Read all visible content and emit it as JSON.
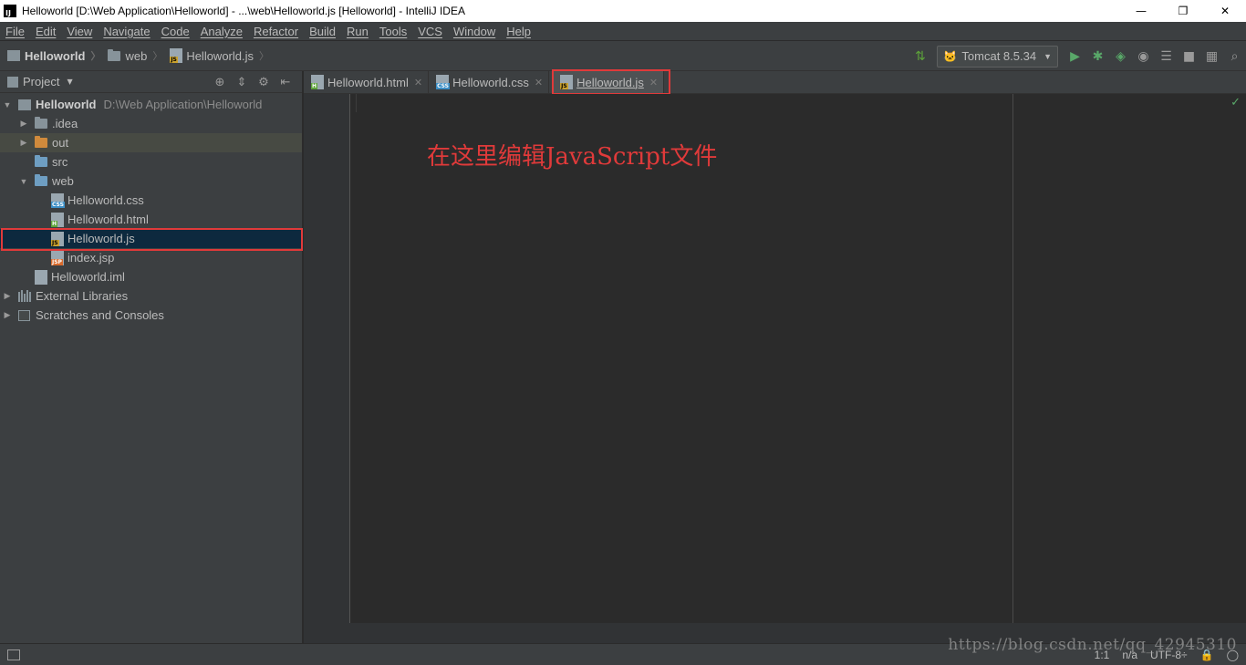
{
  "window": {
    "title": "Helloworld [D:\\Web Application\\Helloworld] - ...\\web\\Helloworld.js [Helloworld] - IntelliJ IDEA",
    "logo_text": "IJ",
    "minimize": "—",
    "restore": "❐",
    "close": "✕"
  },
  "menu": [
    "File",
    "Edit",
    "View",
    "Navigate",
    "Code",
    "Analyze",
    "Refactor",
    "Build",
    "Run",
    "Tools",
    "VCS",
    "Window",
    "Help"
  ],
  "breadcrumb": {
    "project": "Helloworld",
    "folder": "web",
    "file": "Helloworld.js",
    "file_badge": "JS"
  },
  "run_config": {
    "name": "Tomcat 8.5.34"
  },
  "project_panel": {
    "title": "Project"
  },
  "tree": {
    "root": {
      "name": "Helloworld",
      "path": "D:\\Web Application\\Helloworld"
    },
    "idea": ".idea",
    "out": "out",
    "src": "src",
    "web": "web",
    "css": {
      "name": "Helloworld.css",
      "badge": "CSS"
    },
    "html": {
      "name": "Helloworld.html",
      "badge": "H"
    },
    "js": {
      "name": "Helloworld.js",
      "badge": "JS"
    },
    "jsp": {
      "name": "index.jsp",
      "badge": "JSP"
    },
    "iml": "Helloworld.iml",
    "libraries": "External Libraries",
    "scratches": "Scratches and Consoles"
  },
  "tabs": [
    {
      "label": "Helloworld.html",
      "badge": "H"
    },
    {
      "label": "Helloworld.css",
      "badge": "CSS"
    },
    {
      "label": "Helloworld.js",
      "badge": "JS"
    }
  ],
  "editor": {
    "annotation": "在这里编辑JavaScript文件",
    "ok_mark": "✓"
  },
  "status": {
    "position": "1:1",
    "na": "n/a",
    "encoding": "UTF-8÷"
  },
  "watermark": "https://blog.csdn.net/qq_42945310",
  "colors": {
    "accent_red": "#e03a3a",
    "selection": "#0d293e",
    "background": "#2b2b2b",
    "panel": "#3c3f41"
  }
}
